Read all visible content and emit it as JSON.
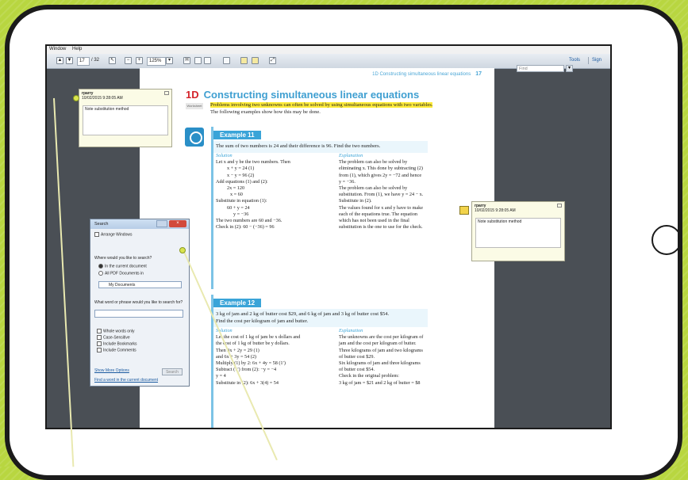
{
  "menubar": {
    "items": [
      "Window",
      "Help"
    ]
  },
  "toolbar": {
    "page_current": "17",
    "page_total": "/ 32",
    "zoom": "125%",
    "tools_label": "Tools",
    "sign_label": "Sign"
  },
  "find": {
    "placeholder": "Find"
  },
  "page": {
    "header": "1D Constructing simultaneous linear equations",
    "page_num": "17",
    "section_num": "1D",
    "section_title": "Constructing simultaneous linear equations",
    "worksheet": "Worksheet",
    "intro_highlight": "Problems involving two unknowns can often be solved by using simultaneous equations with two variables.",
    "intro_rest": " The following examples show how this may be done.",
    "ex11": {
      "label": "Example 11",
      "question": "The sum of two numbers is 24 and their difference is 96. Find the two numbers.",
      "sol_label": "Solution",
      "sol": [
        "Let x and y be the two numbers. Then",
        "x + y = 24     (1)",
        "x − y = 96     (2)",
        "Add equations (1) and (2):",
        "2x = 120",
        "x = 60",
        "Substitute in equation (1):",
        "60 + y = 24",
        "y = −36",
        "The two numbers are 60 and −36.",
        "Check in (2):   60 − (−36) = 96"
      ],
      "exp_label": "Explanation",
      "exp": [
        "The problem can also be solved by",
        "eliminating x. This done by subtracting (2)",
        "from (1), which gives 2y = −72 and hence",
        "y = −36.",
        "The problem can also be solved by",
        "substitution. From (1), we have y = 24 − x.",
        "Substitute in (2).",
        "The values found for x and y have to make",
        "each of the equations true. The equation",
        "which has not been used in the final",
        "substitution is the one to use for the check."
      ]
    },
    "ex12": {
      "label": "Example 12",
      "question1": "3 kg of jam and 2 kg of butter cost $29, and 6 kg of jam and 3 kg of butter cost $54.",
      "question2": "Find the cost per kilogram of jam and butter.",
      "sol_label": "Solution",
      "sol": [
        "Let the cost of 1 kg of jam be x dollars and",
        "the cost of 1 kg of butter be y dollars.",
        "Then              3x + 2y = 29   (1)",
        "and                6x + 3y = 54   (2)",
        "Multiply (1) by 2:   6x + 4y = 58   (1′)",
        "Subtract (1′) from (2):     −y = −4",
        "                                    y = 4",
        "Substitute in (2):   6x + 3(4) = 54"
      ],
      "exp_label": "Explanation",
      "exp": [
        "The unknowns are the cost per kilogram of",
        "jam and the cost per kilogram of butter.",
        "Three kilograms of jam and two kilograms",
        "of butter cost $29.",
        "Six kilograms of jam and three kilograms",
        "of butter cost $54.",
        "Check in the original problem:",
        "3 kg of jam = $21 and 2 kg of butter = $8"
      ]
    }
  },
  "note_left": {
    "author": "rparry",
    "date": "10/02/2015 9:28:05 AM",
    "text": "Note substitution method"
  },
  "note_right": {
    "author": "rparry",
    "date": "10/02/2015 9:28:05 AM",
    "text": "Note substitution method"
  },
  "search": {
    "title": "Search",
    "arrange": "Arrange Windows",
    "where_q": "Where would you like to search?",
    "opt_current": "In the current document",
    "opt_all": "All PDF Documents in",
    "folder": "My Documents",
    "what_q": "What word or phrase would you like to search for?",
    "whole": "Whole words only",
    "case": "Case-Sensitive",
    "bookmarks": "Include Bookmarks",
    "comments": "Include Comments",
    "search_btn": "Search",
    "more_options": "Show More Options",
    "find_link": "Find a word in the current document"
  }
}
